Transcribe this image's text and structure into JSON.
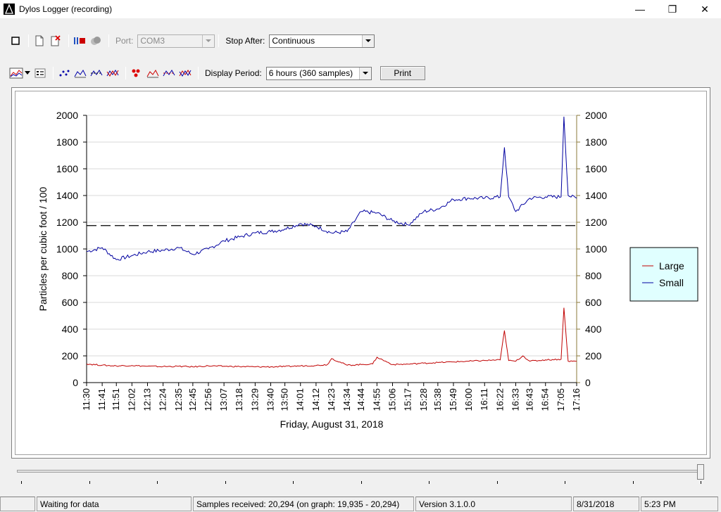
{
  "window": {
    "title": "Dylos Logger (recording)",
    "minimize_glyph": "—",
    "maximize_glyph": "❐",
    "close_glyph": "✕"
  },
  "toolbar1": {
    "port_label": "Port:",
    "port_value": "COM3",
    "stop_after_label": "Stop After:",
    "stop_after_value": "Continuous"
  },
  "toolbar2": {
    "display_period_label": "Display Period:",
    "display_period_value": "6 hours (360 samples)",
    "print_label": "Print"
  },
  "status": {
    "message": "Waiting for data",
    "samples": "Samples received: 20,294  (on graph: 19,935 - 20,294)",
    "version": "Version 3.1.0.0",
    "date": "8/31/2018",
    "time": "5:23 PM"
  },
  "colors": {
    "small": "#0000a0",
    "large": "#c00000",
    "legend_bg": "#e0ffff",
    "axis": "#000000",
    "grid": "#d8d8d8",
    "right_axis": "#8b7a3a"
  },
  "chart_data": {
    "type": "line",
    "ylabel": "Particles per cubic foot / 100",
    "xlabel": "Friday, August 31, 2018",
    "ylim": [
      0,
      2000
    ],
    "yticks": [
      0,
      200,
      400,
      600,
      800,
      1000,
      1200,
      1400,
      1600,
      1800,
      2000
    ],
    "xtick_labels": [
      "11:30",
      "11:41",
      "11:51",
      "12:02",
      "12:13",
      "12:24",
      "12:35",
      "12:45",
      "12:56",
      "13:07",
      "13:18",
      "13:29",
      "13:40",
      "13:50",
      "14:01",
      "14:12",
      "14:23",
      "14:34",
      "14:44",
      "14:55",
      "15:06",
      "15:17",
      "15:28",
      "15:38",
      "15:49",
      "16:00",
      "16:11",
      "16:22",
      "16:33",
      "16:43",
      "16:54",
      "17:05",
      "17:16"
    ],
    "reference_line": 1175,
    "grid": true,
    "legend_position": "right",
    "series": [
      {
        "name": "Small",
        "x": [
          "11:30",
          "11:41",
          "11:51",
          "12:02",
          "12:13",
          "12:24",
          "12:35",
          "12:45",
          "12:56",
          "13:07",
          "13:18",
          "13:29",
          "13:40",
          "13:50",
          "14:01",
          "14:12",
          "14:23",
          "14:34",
          "14:44",
          "14:55",
          "15:06",
          "15:17",
          "15:28",
          "15:38",
          "15:49",
          "16:00",
          "16:11",
          "16:22",
          "16:25",
          "16:28",
          "16:33",
          "16:43",
          "16:54",
          "17:05",
          "17:07",
          "17:10",
          "17:16"
        ],
        "values": [
          980,
          1010,
          920,
          950,
          980,
          990,
          1010,
          960,
          1000,
          1060,
          1090,
          1120,
          1130,
          1150,
          1190,
          1170,
          1120,
          1130,
          1280,
          1270,
          1210,
          1180,
          1280,
          1300,
          1370,
          1380,
          1380,
          1390,
          1760,
          1390,
          1280,
          1380,
          1390,
          1390,
          1990,
          1400,
          1380
        ]
      },
      {
        "name": "Large",
        "x": [
          "11:30",
          "11:41",
          "11:51",
          "12:02",
          "12:13",
          "12:24",
          "12:35",
          "12:45",
          "12:56",
          "13:07",
          "13:18",
          "13:29",
          "13:40",
          "13:50",
          "14:01",
          "14:12",
          "14:20",
          "14:23",
          "14:34",
          "14:44",
          "14:52",
          "14:55",
          "15:06",
          "15:17",
          "15:28",
          "15:38",
          "15:49",
          "16:00",
          "16:11",
          "16:22",
          "16:25",
          "16:28",
          "16:33",
          "16:38",
          "16:43",
          "16:54",
          "17:05",
          "17:07",
          "17:10",
          "17:16"
        ],
        "values": [
          140,
          130,
          125,
          128,
          122,
          120,
          122,
          118,
          125,
          122,
          120,
          118,
          118,
          120,
          125,
          128,
          135,
          180,
          130,
          135,
          140,
          190,
          135,
          138,
          145,
          150,
          155,
          160,
          165,
          170,
          390,
          165,
          160,
          200,
          160,
          170,
          175,
          560,
          160,
          160
        ]
      }
    ]
  }
}
